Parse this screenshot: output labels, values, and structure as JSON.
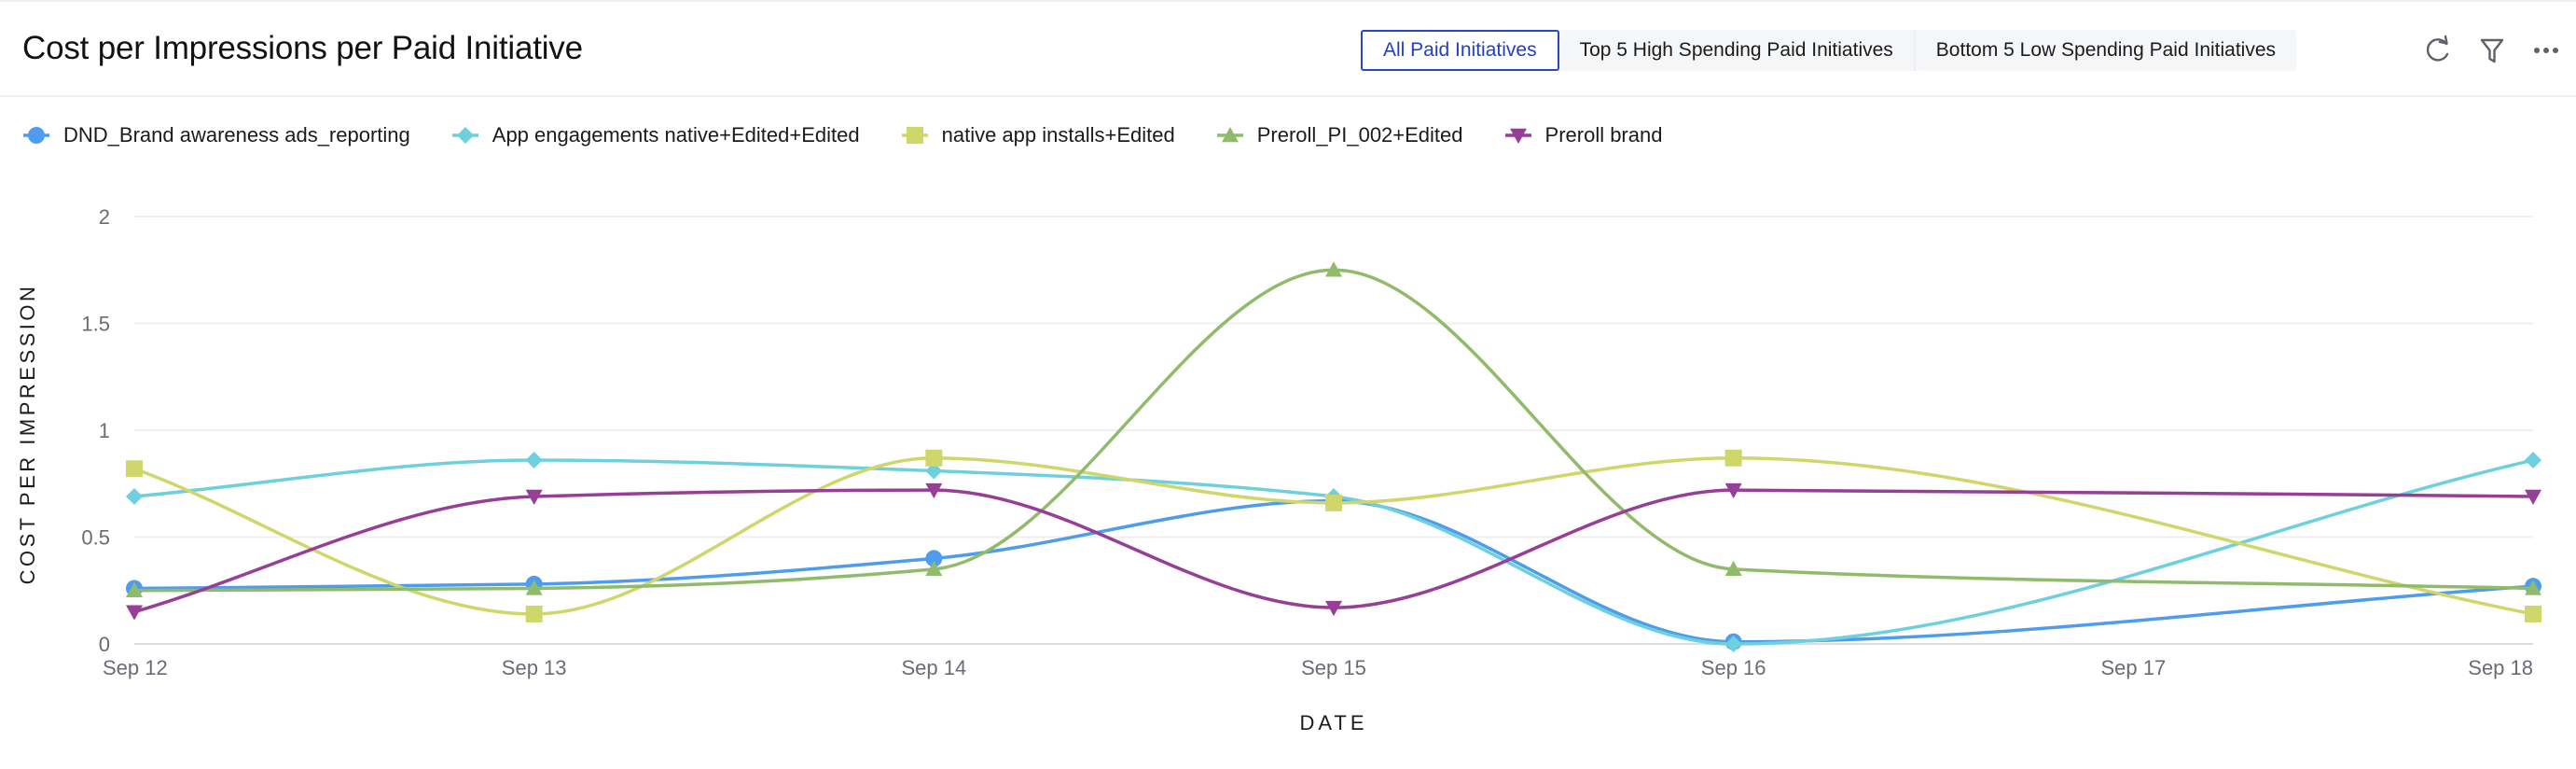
{
  "header": {
    "title": "Cost per Impressions per Paid Initiative",
    "segments": [
      {
        "label": "All Paid Initiatives",
        "active": true
      },
      {
        "label": "Top 5 High Spending Paid Initiatives",
        "active": false
      },
      {
        "label": "Bottom 5 Low Spending Paid Initiatives",
        "active": false
      }
    ],
    "actions": [
      {
        "name": "refresh-icon"
      },
      {
        "name": "filter-icon"
      },
      {
        "name": "more-options-icon"
      }
    ]
  },
  "colors": {
    "accent": "#2a47c9",
    "grid": "#efeff1",
    "axis": "#dcdce0",
    "tick_text": "#6b6b76"
  },
  "chart_data": {
    "type": "line",
    "title": "Cost per Impressions per Paid Initiative",
    "xlabel": "DATE",
    "ylabel": "COST PER IMPRESSION",
    "categories": [
      "Sep 12",
      "Sep 13",
      "Sep 14",
      "Sep 15",
      "Sep 16",
      "Sep 17",
      "Sep 18"
    ],
    "ylim": [
      0,
      2
    ],
    "yticks": [
      0,
      0.5,
      1,
      1.5,
      2
    ],
    "ytick_labels": [
      "0",
      "0.5",
      "1",
      "1.5",
      "2"
    ],
    "grid": true,
    "legend_position": "top-left",
    "smooth": true,
    "series": [
      {
        "name": "DND_Brand awareness ads_reporting",
        "color": "#4e9cee",
        "marker": "circle",
        "values": [
          0.26,
          0.28,
          0.4,
          0.67,
          0.01,
          null,
          0.27
        ]
      },
      {
        "name": "App engagements native+Edited+Edited",
        "color": "#6dd0dc",
        "marker": "diamond",
        "values": [
          0.69,
          0.86,
          0.81,
          0.69,
          0.0,
          null,
          0.86
        ]
      },
      {
        "name": "native app installs+Edited",
        "color": "#cfd66a",
        "marker": "square",
        "values": [
          0.82,
          0.14,
          0.87,
          0.66,
          0.87,
          null,
          0.14
        ]
      },
      {
        "name": "Preroll_PI_002+Edited",
        "color": "#8fbb6a",
        "marker": "triangle-up",
        "values": [
          0.25,
          0.26,
          0.35,
          1.75,
          0.35,
          null,
          0.26
        ]
      },
      {
        "name": "Preroll brand",
        "color": "#973f97",
        "marker": "triangle-down",
        "values": [
          0.15,
          0.69,
          0.72,
          0.17,
          0.72,
          null,
          0.69
        ]
      }
    ]
  }
}
